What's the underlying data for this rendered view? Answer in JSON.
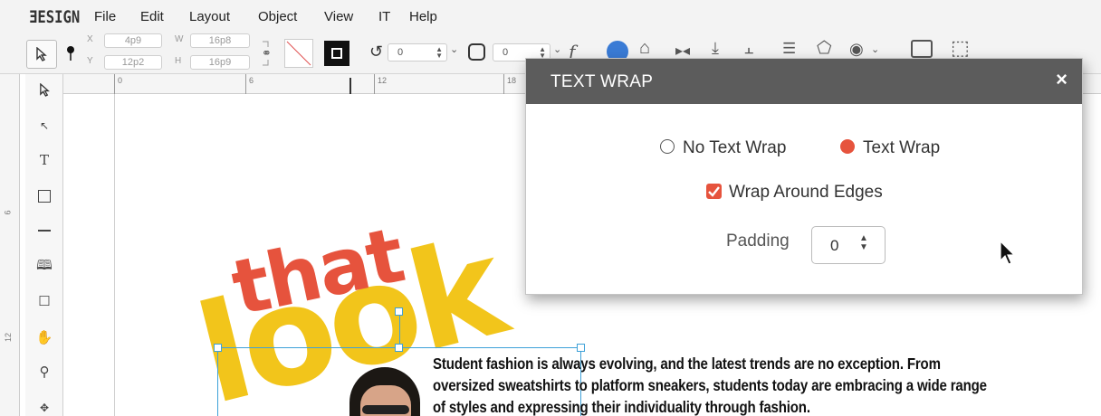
{
  "app": {
    "logo": "ƎESIGN"
  },
  "menu": [
    "File",
    "Edit",
    "Layout",
    "Object",
    "View",
    "IT",
    "Help"
  ],
  "control_bar": {
    "x_label": "X",
    "x_value": "4p9",
    "y_label": "Y",
    "y_value": "12p2",
    "w_label": "W",
    "w_value": "16p8",
    "h_label": "H",
    "h_value": "16p9",
    "rotate_value": "0",
    "corner_value": "0"
  },
  "ruler": {
    "h_numbers": [
      "0",
      "6",
      "12",
      "18"
    ],
    "v_numbers": [
      "6",
      "12"
    ]
  },
  "artwork": {
    "word1": "that",
    "word2": "look"
  },
  "body_text": "Student fashion is always evolving, and the latest trends are no exception. From oversized sweatshirts to platform sneakers, students today are embracing a wide range of styles and expressing their individuality through fashion.",
  "dialog": {
    "title": "TEXT WRAP",
    "close": "×",
    "option_no_wrap": "No Text Wrap",
    "option_wrap": "Text Wrap",
    "selected_option": "Text Wrap",
    "wrap_edges_label": "Wrap Around Edges",
    "wrap_edges_checked": true,
    "padding_label": "Padding",
    "padding_value": "0"
  },
  "colors": {
    "accent": "#e6533d",
    "dialog_header": "#5c5c5c",
    "selection": "#3ea1d8",
    "yellow": "#f2c51b"
  }
}
